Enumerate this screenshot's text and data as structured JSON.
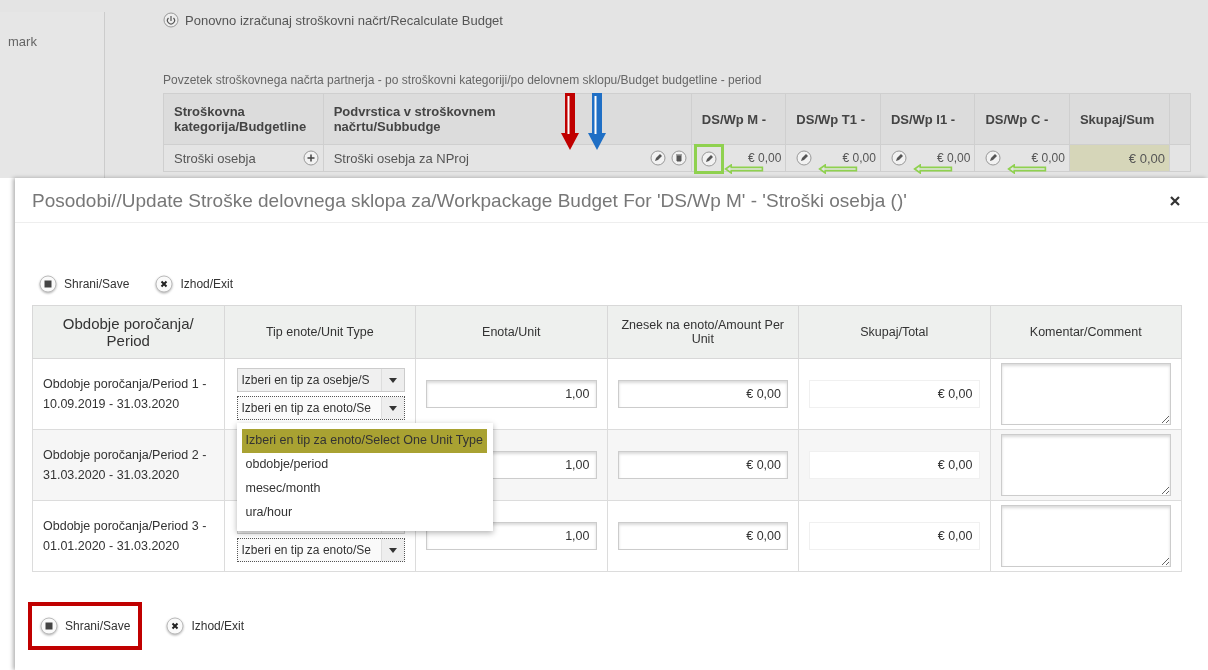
{
  "sidebar": {
    "items": [
      "mark"
    ]
  },
  "recalculate_button": {
    "label": "Ponovno izračunaj stroškovni načrt/Recalculate Budget"
  },
  "summary": {
    "caption": "Povzetek stroškovnega načrta partnerja - po stroškovni kategoriji/po delovnem sklopu/Budget budgetline - period",
    "columns": [
      "Stroškovna kategorija/Budgetline",
      "Podvrstica v stroškovnem načrtu/Subbudge",
      "DS/Wp M -",
      "DS/Wp T1 -",
      "DS/Wp I1 -",
      "DS/Wp C -",
      "Skupaj/Sum"
    ],
    "rows": [
      {
        "budgetline": "Stroški osebja",
        "subbudgetline": "Stroški osebja za NProj",
        "values": [
          {
            "value": "€ 0,00",
            "highlighted": true
          },
          {
            "value": "€ 0,00",
            "highlighted": false
          },
          {
            "value": "€ 0,00",
            "highlighted": false
          },
          {
            "value": "€ 0,00",
            "highlighted": false
          }
        ],
        "sum": "€ 0,00"
      }
    ]
  },
  "annotation_arrows": [
    {
      "color": "#c00000"
    },
    {
      "color": "#1f6fc5"
    }
  ],
  "modal": {
    "title": "Posodobi//Update Stroške delovnega sklopa za/Workpackage Budget For 'DS/Wp M' - 'Stroški osebja ()'",
    "top_toolbar": [
      {
        "kind": "save",
        "label": "Shrani/Save",
        "highlighted": false
      },
      {
        "kind": "exit",
        "label": "Izhod/Exit",
        "highlighted": false
      }
    ],
    "columns": [
      "Obdobje poročanja/ Period",
      "Tip enote/Unit Type",
      "Enota/Unit",
      "Znesek na enoto/Amount Per Unit",
      "Skupaj/Total",
      "Komentar/Comment"
    ],
    "rows": [
      {
        "period": "Obdobje poročanja/Period 1 - 10.09.2019 - 31.03.2020",
        "person_type": "Izberi en tip za osebje/S",
        "unit_type": "Izberi en tip za enoto/Se",
        "unit": "1,00",
        "amount": "€ 0,00",
        "total": "€ 0,00"
      },
      {
        "period": "Obdobje poročanja/Period 2 - 31.03.2020 - 31.03.2020",
        "unit": "1,00",
        "amount": "€ 0,00",
        "total": "€ 0,00"
      },
      {
        "period": "Obdobje poročanja/Period 3 - 01.01.2020 - 31.03.2020",
        "unit_type": "Izberi en tip za enoto/Se",
        "unit": "1,00",
        "amount": "€ 0,00",
        "total": "€ 0,00"
      }
    ],
    "dropdown": {
      "options": [
        {
          "label": "Izberi en tip za enoto/Select One Unit Type",
          "selected": true
        },
        {
          "label": "obdobje/period",
          "selected": false
        },
        {
          "label": "mesec/month",
          "selected": false
        },
        {
          "label": "ura/hour",
          "selected": false
        }
      ]
    },
    "bottom_toolbar": [
      {
        "kind": "save",
        "label": "Shrani/Save",
        "highlighted": true
      },
      {
        "kind": "exit",
        "label": "Izhod/Exit",
        "highlighted": false
      }
    ]
  }
}
